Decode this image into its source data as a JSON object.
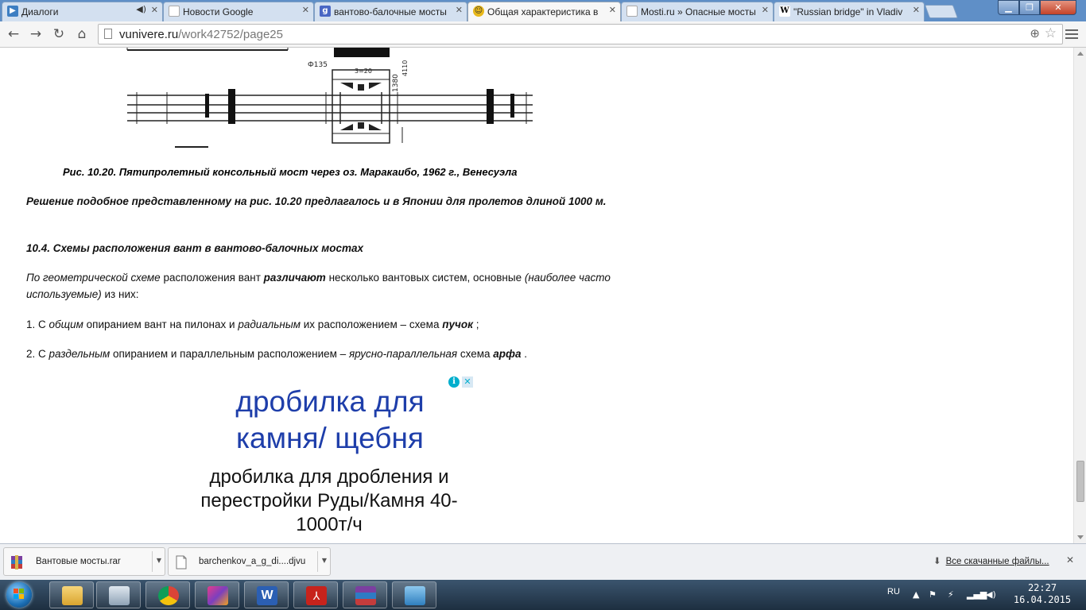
{
  "tabs": [
    {
      "title": "Диалоги",
      "favicon": "play-box-icon",
      "color": "#3d7ec2",
      "has_sound": true
    },
    {
      "title": "Новости Google",
      "favicon": "page-icon",
      "color": "#cccccc"
    },
    {
      "title": "вантово-балочные мосты",
      "favicon": "google-search-icon",
      "color": "#4a67c4"
    },
    {
      "title": "Общая характеристика в",
      "favicon": "smiley-icon",
      "color": "#e8b81a",
      "active": true
    },
    {
      "title": "Mosti.ru » Опасные мосты",
      "favicon": "page-icon",
      "color": "#cccccc"
    },
    {
      "title": "\"Russian bridge\" in Vladiv",
      "favicon": "wikipedia-icon",
      "color": "#ffffff"
    }
  ],
  "toolbar": {
    "url_host": "vunivere.ru",
    "url_path": "/work42752/page25"
  },
  "article": {
    "figure_caption": "Рис. 10.20. Пятипролетный консольный мост через оз. Маракаибо, 1962 г., Венесуэла",
    "p1": "Решение подобное представленному на рис. 10.20 предлагалось и в Японии для пролетов длиной 1000 м.",
    "heading": "10.4. Схемы расположения вант в вантово-балочных мостах",
    "p2": {
      "a": "По геометрической схеме",
      "b": " расположения вант ",
      "c": "различают",
      "d": "  несколько вантовых систем, основные ",
      "e": "(наиболее часто используемые)",
      "f": " из них:"
    },
    "item1": {
      "a": "1. С ",
      "b": "общим",
      "c": " опиранием вант на пилонах и ",
      "d": "радиальным",
      "e": " их расположением – схема ",
      "f": "пучок",
      "g": " ;"
    },
    "item2": {
      "a": "2. С ",
      "b": "раздельным",
      "c": " опиранием и параллельным расположением – ",
      "d": "ярусно-параллельная",
      "e": " схема ",
      "f": "арфа",
      "g": " ."
    },
    "figure_labels": {
      "dia": "Ф135",
      "dim1": "3=20",
      "dim2": "1380",
      "dim3": "4110"
    }
  },
  "ad": {
    "title": "дробилка для камня/ щебня",
    "description": "дробилка для дробления и перестройки Руды/Камня 40-1000т/ч",
    "title_color": "#1e3eaa"
  },
  "downloads": {
    "items": [
      {
        "name": "Вантовые мосты.rar",
        "icon": "winrar-icon"
      },
      {
        "name": "barchenkov_a_g_di....djvu",
        "icon": "document-icon"
      }
    ],
    "show_all": "Все скачанные файлы..."
  },
  "taskbar": {
    "apps": [
      "explorer-icon",
      "calculator-icon",
      "chrome-icon",
      "app-icon",
      "word-icon",
      "acrobat-icon",
      "winrar-icon",
      "photo-viewer-icon"
    ],
    "lang": "RU",
    "time": "22:27",
    "date": "16.04.2015"
  }
}
